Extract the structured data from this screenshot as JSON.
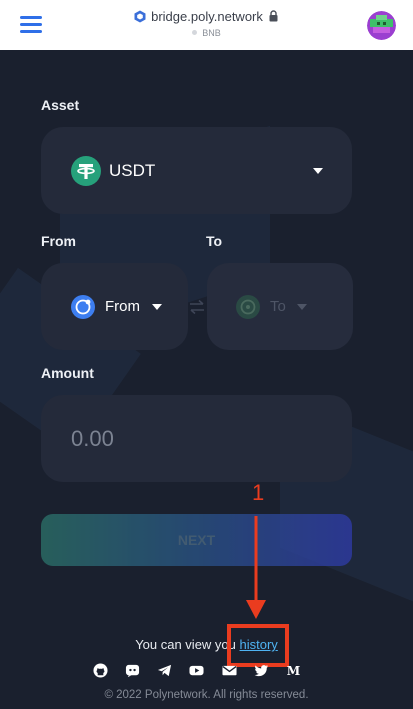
{
  "browser": {
    "url": "bridge.poly.network",
    "network": "BNB"
  },
  "colors": {
    "background": "#1a202e",
    "card": "#242a3a",
    "link": "#4fb3f2",
    "annotation": "#ea3c1f",
    "button_gradient": [
      "#2a6e66",
      "#2e3aa4"
    ]
  },
  "form": {
    "asset_label": "Asset",
    "asset_value": "USDT",
    "asset_icon": "tether-icon",
    "from_label": "From",
    "from_value": "From",
    "to_label": "To",
    "to_value": "To",
    "amount_label": "Amount",
    "amount_placeholder": "0.00",
    "next_label": "NEXT"
  },
  "history": {
    "text": "You can view you",
    "link": "history"
  },
  "annotation": {
    "number": "1"
  },
  "social_icons": [
    "github-icon",
    "discord-icon",
    "telegram-icon",
    "youtube-icon",
    "mail-icon",
    "twitter-icon",
    "medium-icon"
  ],
  "footer": "© 2022 Polynetwork. All rights reserved."
}
